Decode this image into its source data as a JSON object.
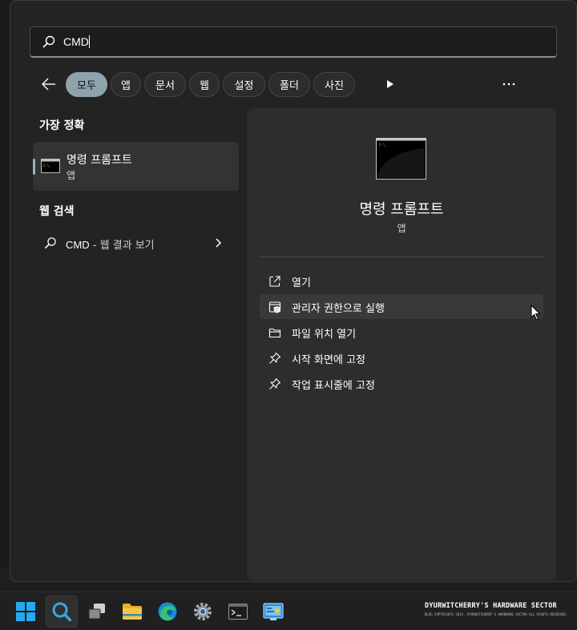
{
  "search": {
    "value": "CMD"
  },
  "filters": {
    "chips": [
      {
        "label": "모두",
        "active": true
      },
      {
        "label": "앱"
      },
      {
        "label": "문서"
      },
      {
        "label": "웹"
      },
      {
        "label": "설정"
      },
      {
        "label": "폴더"
      },
      {
        "label": "사진"
      }
    ],
    "more_icon": "ellipsis-icon"
  },
  "best_match": {
    "title": "가장 정확",
    "item": {
      "name": "명령 프롬프트",
      "type": "앱",
      "icon": "command-prompt-icon"
    }
  },
  "web_search": {
    "title": "웹 검색",
    "item": {
      "query": "CMD",
      "suffix": "- 웹 결과 보기",
      "icon": "search-icon"
    }
  },
  "details": {
    "title": "명령 프롬프트",
    "subtitle": "앱",
    "actions": [
      {
        "label": "열기",
        "icon": "open-external-icon"
      },
      {
        "label": "관리자 권한으로 실행",
        "icon": "admin-shield-icon",
        "hover": true
      },
      {
        "label": "파일 위치 열기",
        "icon": "folder-icon"
      },
      {
        "label": "시작 화면에 고정",
        "icon": "pin-icon"
      },
      {
        "label": "작업 표시줄에 고정",
        "icon": "pin-icon"
      }
    ]
  },
  "taskbar": {
    "items": [
      "windows-start-icon",
      "search-icon",
      "task-view-icon",
      "file-explorer-icon",
      "edge-icon",
      "settings-icon",
      "terminal-icon",
      "control-panel-icon"
    ]
  },
  "watermark": {
    "main": "DYURWITCHERRY'S HARDWARE SECTOR",
    "small": "BLOG COPYRIGHT© 2015. DYURWITCHERRY'S HARDWARE SECTOR ALL RIGHTS RESERVED."
  },
  "colors": {
    "accent_chip": "#8fa3ad",
    "panel": "#232323",
    "details_pane": "#2d2d2d",
    "hover_row": "#393939"
  }
}
